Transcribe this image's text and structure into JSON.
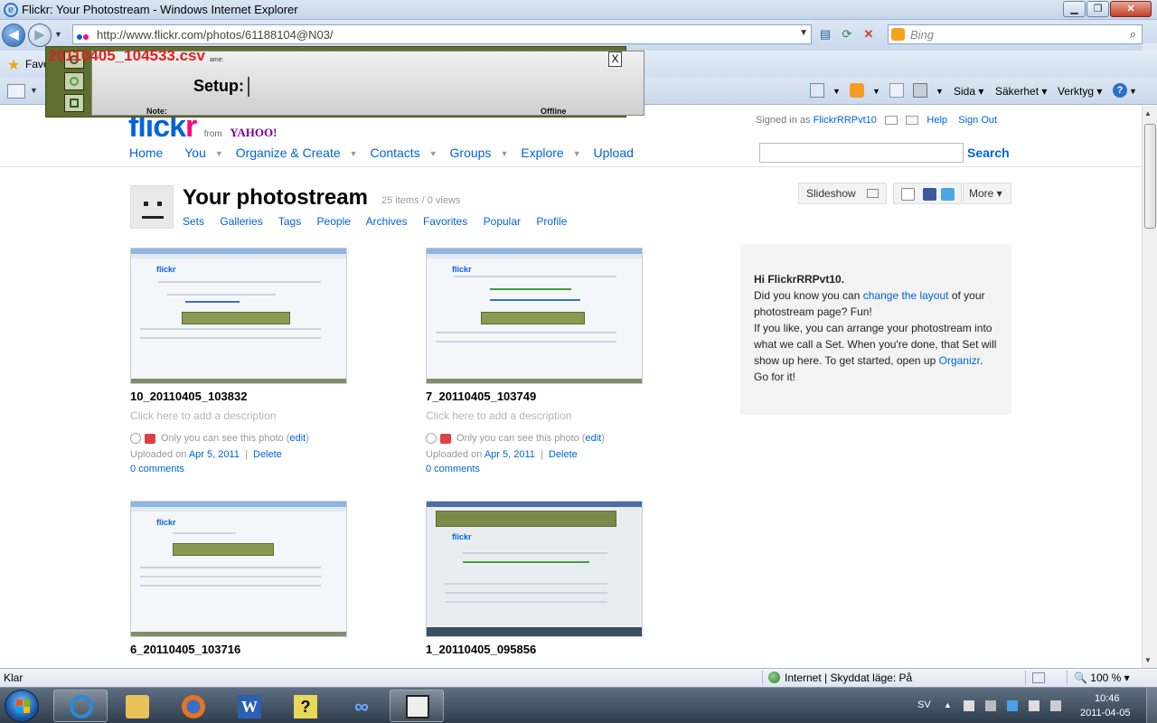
{
  "window": {
    "title": "Flickr: Your Photostream - Windows Internet Explorer",
    "min": "▁",
    "max": "❐",
    "close": "✕"
  },
  "browser": {
    "address": "http://www.flickr.com/photos/61188104@N03/",
    "search_placeholder": "Bing",
    "favorites_label": "Favo",
    "commands": {
      "page": "Sida",
      "safety": "Säkerhet",
      "tools": "Verktyg"
    }
  },
  "overlay": {
    "filename": "20110405_104533.csv",
    "setup_label": "Setup:",
    "note_label": "Note:",
    "status": "Offline",
    "small_label": "ame:",
    "close": "X"
  },
  "flickr": {
    "logo": {
      "flick": "flick",
      "r": "r",
      "from": "from",
      "yahoo": "YAHOO!"
    },
    "signed_in_prefix": "Signed in as",
    "username": "FlickrRRPvt10",
    "help": "Help",
    "signout": "Sign Out",
    "nav": {
      "home": "Home",
      "you": "You",
      "organize": "Organize & Create",
      "contacts": "Contacts",
      "groups": "Groups",
      "explore": "Explore",
      "upload": "Upload"
    },
    "search_button": "Search",
    "page_title": "Your photostream",
    "counts": "25 items / 0 views",
    "subnav": [
      "Sets",
      "Galleries",
      "Tags",
      "People",
      "Archives",
      "Favorites",
      "Popular",
      "Profile"
    ],
    "slideshow": "Slideshow",
    "more": "More ▾"
  },
  "photos": [
    {
      "title": "10_20110405_103832",
      "desc": "Click here to add a description",
      "privacy": "Only you can see this photo",
      "edit": "edit",
      "uploaded_prefix": "Uploaded on",
      "date": "Apr 5, 2011",
      "delete": "Delete",
      "comments": "0 comments"
    },
    {
      "title": "7_20110405_103749",
      "desc": "Click here to add a description",
      "privacy": "Only you can see this photo",
      "edit": "edit",
      "uploaded_prefix": "Uploaded on",
      "date": "Apr 5, 2011",
      "delete": "Delete",
      "comments": "0 comments"
    },
    {
      "title": "6_20110405_103716"
    },
    {
      "title": "1_20110405_095856"
    }
  ],
  "tip": {
    "hi": "Hi FlickrRRPvt10.",
    "line1_pre": "Did you know you can",
    "line1_link": "change the layout",
    "line1_post": "of your photostream page? Fun!",
    "line2_pre": "If you like, you can arrange your photostream into what we call a Set. When you're done, that Set will show up here. To get started, open up",
    "line2_link": "Organizr",
    "line2_post": ". Go for it!"
  },
  "status": {
    "left": "Klar",
    "zone": "Internet | Skyddat läge: På",
    "zoom": "100 %"
  },
  "taskbar": {
    "lang": "SV",
    "time": "10:46",
    "date": "2011-04-05"
  },
  "colors": {
    "flickr_blue": "#0063dc",
    "flickr_pink": "#ff0084",
    "overlay_green": "#5f6f2f",
    "overlay_filename_red": "#e02020"
  }
}
